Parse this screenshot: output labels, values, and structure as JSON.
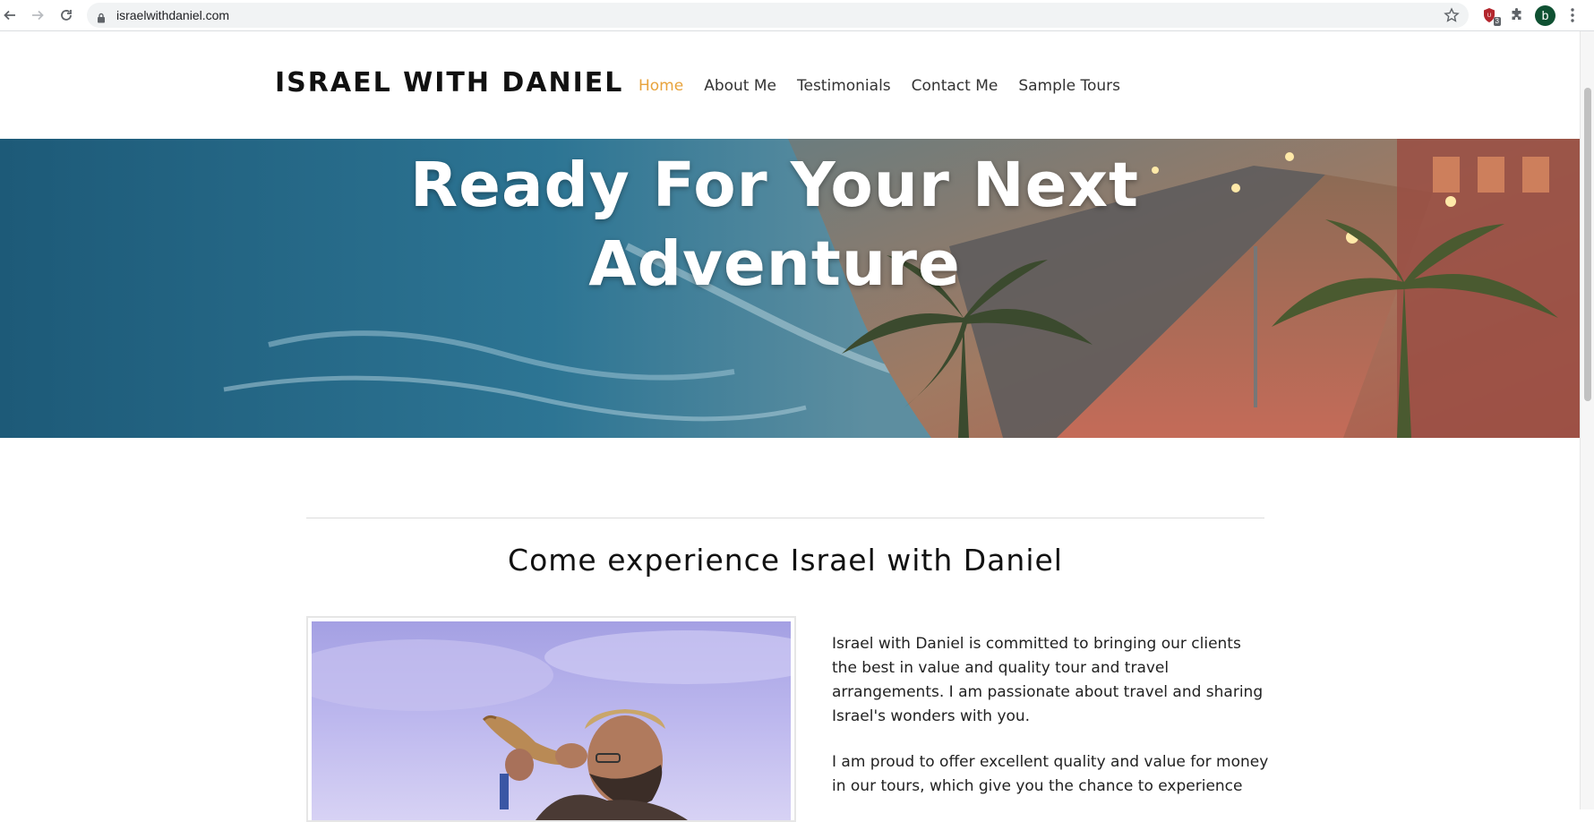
{
  "browser": {
    "url": "israelwithdaniel.com",
    "extension_badge": "3",
    "profile_initial": "b"
  },
  "site": {
    "logo": "ISRAEL WITH DANIEL",
    "nav": [
      {
        "label": "Home",
        "active": true
      },
      {
        "label": "About Me",
        "active": false
      },
      {
        "label": "Testimonials",
        "active": false
      },
      {
        "label": "Contact Me",
        "active": false
      },
      {
        "label": "Sample Tours",
        "active": false
      }
    ],
    "accent_color": "#e8a33c"
  },
  "hero": {
    "title_line1": "Ready For Your Next",
    "title_line2": "Adventure"
  },
  "intro": {
    "heading": "Come experience Israel with Daniel",
    "paragraph1": "Israel with Daniel is committed to bringing our clients the best in value and quality tour and travel arrangements. I am passionate about travel and sharing Israel's wonders with you.",
    "paragraph2": "I am proud to offer excellent quality and value for money in our tours, which give you the chance to experience"
  }
}
